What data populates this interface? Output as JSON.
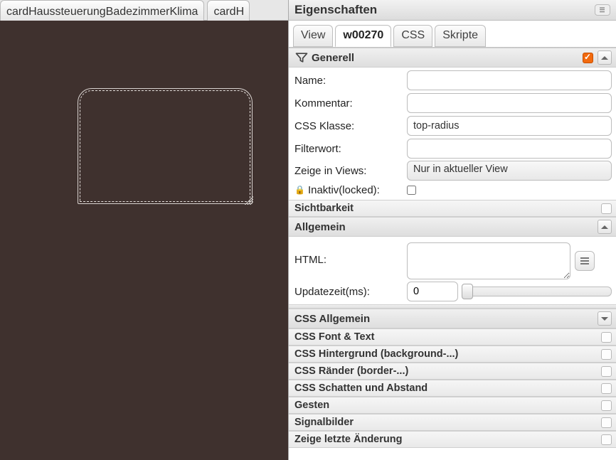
{
  "tabs": {
    "tab1": "cardHaussteuerungBadezimmerKlima",
    "tab2": "cardH"
  },
  "panel": {
    "title": "Eigenschaften",
    "subtabs": {
      "view": "View",
      "widget": "w00270",
      "css": "CSS",
      "scripts": "Skripte"
    }
  },
  "sections": {
    "generell": "Generell",
    "sichtbarkeit": "Sichtbarkeit",
    "allgemein": "Allgemein",
    "css_allgemein": "CSS Allgemein",
    "css_font": "CSS Font & Text",
    "css_bg": "CSS Hintergrund (background-...)",
    "css_border": "CSS Ränder (border-...)",
    "css_shadow": "CSS Schatten und Abstand",
    "gesten": "Gesten",
    "signal": "Signalbilder",
    "lastchange": "Zeige letzte Änderung"
  },
  "generell": {
    "name_label": "Name:",
    "name_value": "",
    "comment_label": "Kommentar:",
    "comment_value": "",
    "cssclass_label": "CSS Klasse:",
    "cssclass_value": "top-radius",
    "filter_label": "Filterwort:",
    "filter_value": "",
    "showinviews_label": "Zeige in Views:",
    "showinviews_value": "Nur in aktueller View",
    "locked_label": "Inaktiv(locked):"
  },
  "allgemein": {
    "html_label": "HTML:",
    "html_value": "",
    "update_label": "Updatezeit(ms):",
    "update_value": "0"
  }
}
